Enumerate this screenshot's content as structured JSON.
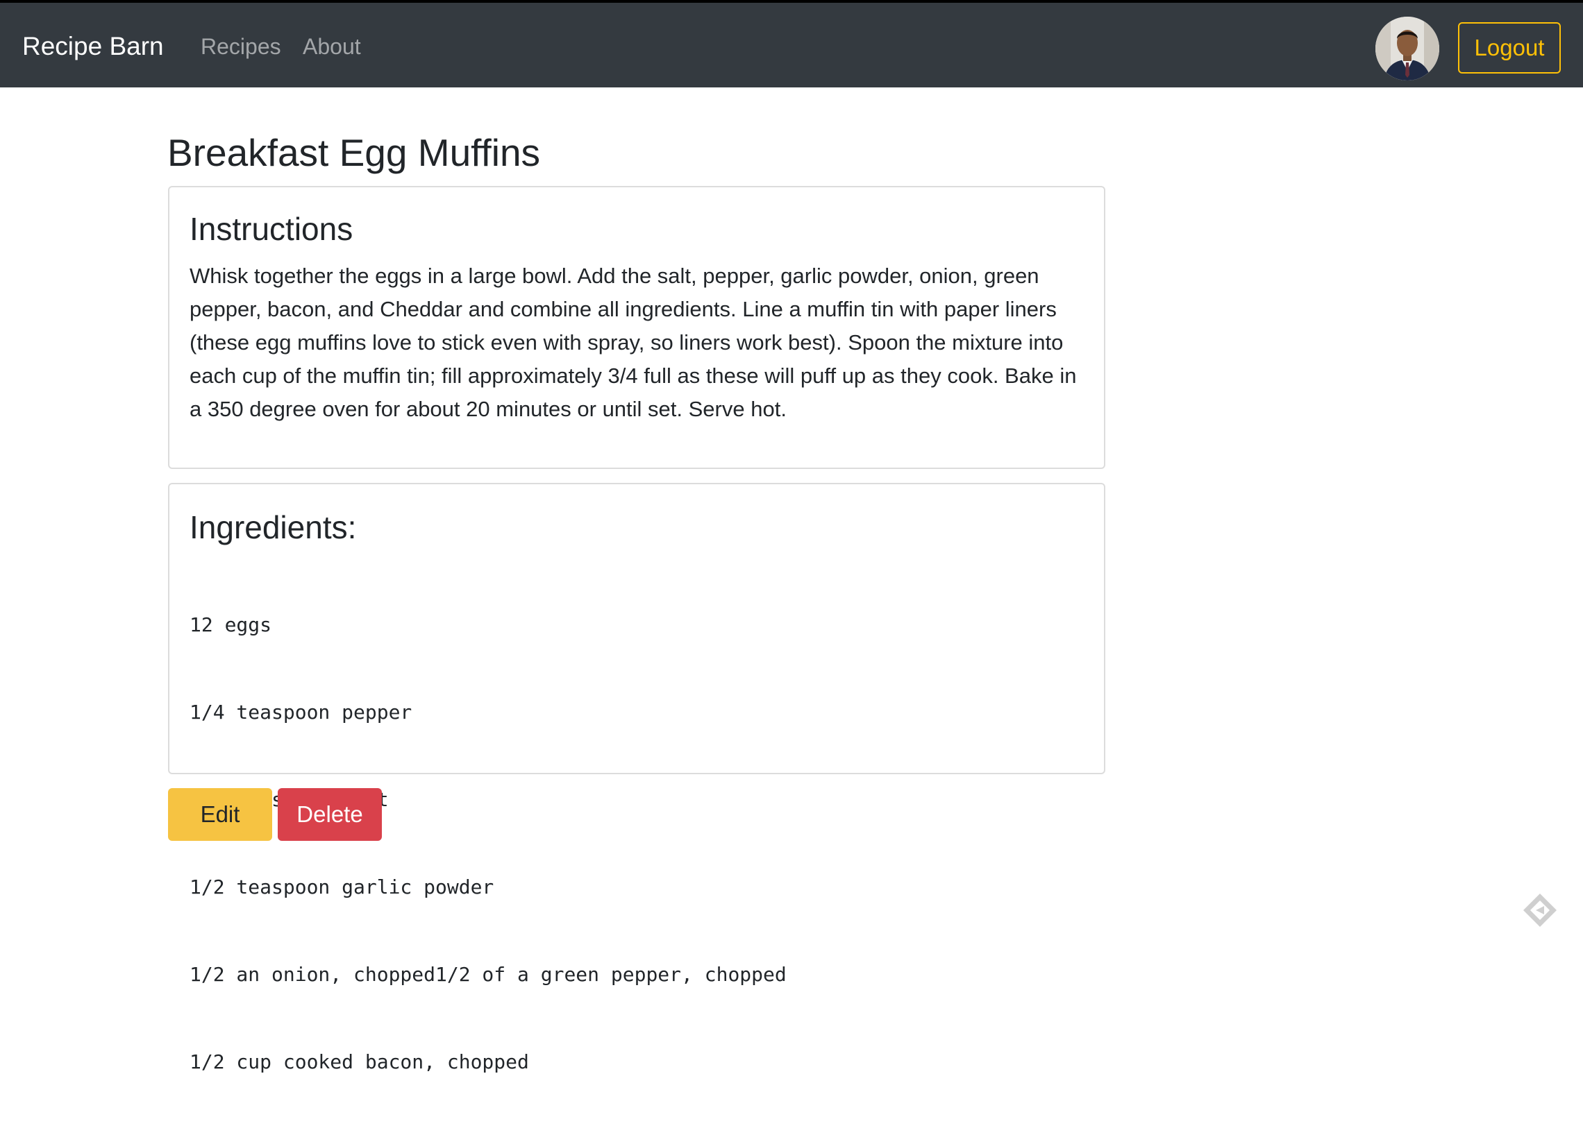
{
  "navbar": {
    "brand": "Recipe Barn",
    "links": [
      "Recipes",
      "About"
    ],
    "logout_label": "Logout",
    "avatar_icon": "user-avatar-photo",
    "bg_color": "#343a40",
    "accent_color": "#ffc107"
  },
  "recipe": {
    "title": "Breakfast Egg Muffins",
    "instructions_heading": "Instructions",
    "instructions": "Whisk together the eggs in a large bowl. Add the salt, pepper, garlic powder, onion, green pepper, bacon, and Cheddar and combine all ingredients. Line a muffin tin with paper liners (these egg muffins love to stick even with spray, so liners work best). Spoon the mixture into each cup of the muffin tin; fill approximately 3/4 full as these will puff up as they cook. Bake in a 350 degree oven for about 20 minutes or until set. Serve hot.",
    "ingredients_heading": "Ingredients:",
    "ingredients": [
      "12 eggs",
      "1/4 teaspoon pepper",
      "1/2 teaspoon salt",
      "1/2 teaspoon garlic powder",
      "1/2 an onion, chopped1/2 of a green pepper, chopped",
      "1/2 cup cooked bacon, chopped"
    ]
  },
  "actions": {
    "edit_label": "Edit",
    "delete_label": "Delete",
    "edit_color": "#f6c342",
    "delete_color": "#d9414b"
  },
  "corner_icon": "diamond-logo-icon"
}
